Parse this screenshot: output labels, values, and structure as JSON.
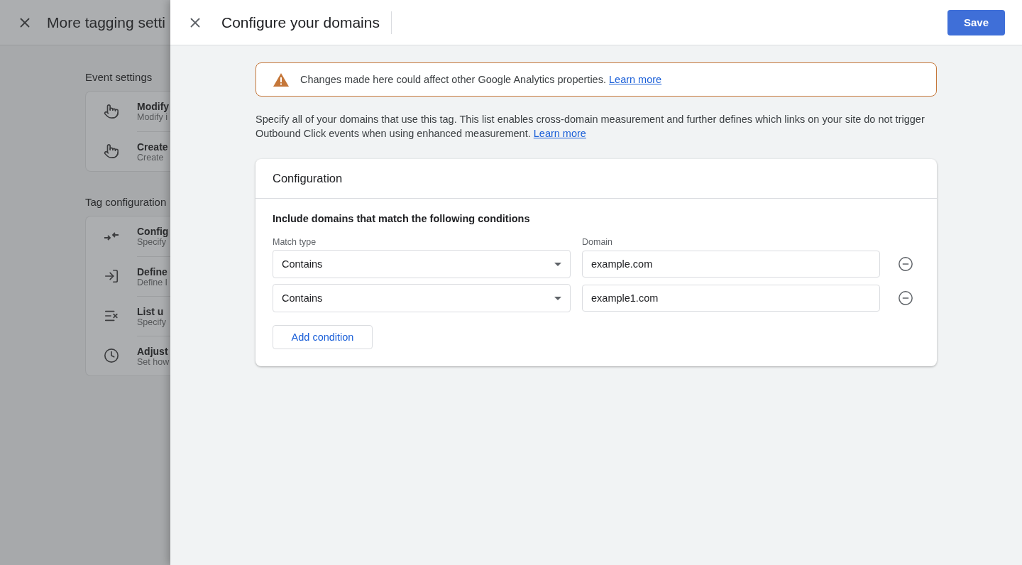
{
  "background_panel": {
    "title": "More tagging setti",
    "sections": [
      {
        "heading": "Event settings",
        "items": [
          {
            "kind": "pointer",
            "title": "Modify",
            "subtitle": "Modify i"
          },
          {
            "kind": "pointer",
            "title": "Create",
            "subtitle": "Create"
          }
        ]
      },
      {
        "heading": "Tag configuration",
        "items": [
          {
            "kind": "arrows",
            "title": "Config",
            "subtitle": "Specify"
          },
          {
            "kind": "enter",
            "title": "Define",
            "subtitle": "Define I"
          },
          {
            "kind": "list",
            "title": "List u",
            "subtitle": "Specify"
          },
          {
            "kind": "clock",
            "title": "Adjust",
            "subtitle": "Set how"
          }
        ]
      }
    ]
  },
  "dialog": {
    "title": "Configure your domains",
    "save_label": "Save",
    "warning": {
      "text": "Changes made here could affect other Google Analytics properties.",
      "link": "Learn more"
    },
    "description": {
      "text": "Specify all of your domains that use this tag. This list enables cross-domain measurement and further defines which links on your site do not trigger Outbound Click events when using enhanced measurement.",
      "link": "Learn more"
    },
    "card": {
      "title": "Configuration",
      "heading": "Include domains that match the following conditions",
      "columns": [
        "Match type",
        "Domain"
      ],
      "conditions": [
        {
          "match_type": "Contains",
          "domain": "example.com"
        },
        {
          "match_type": "Contains",
          "domain": "example1.com"
        }
      ],
      "add_label": "Add condition"
    }
  }
}
